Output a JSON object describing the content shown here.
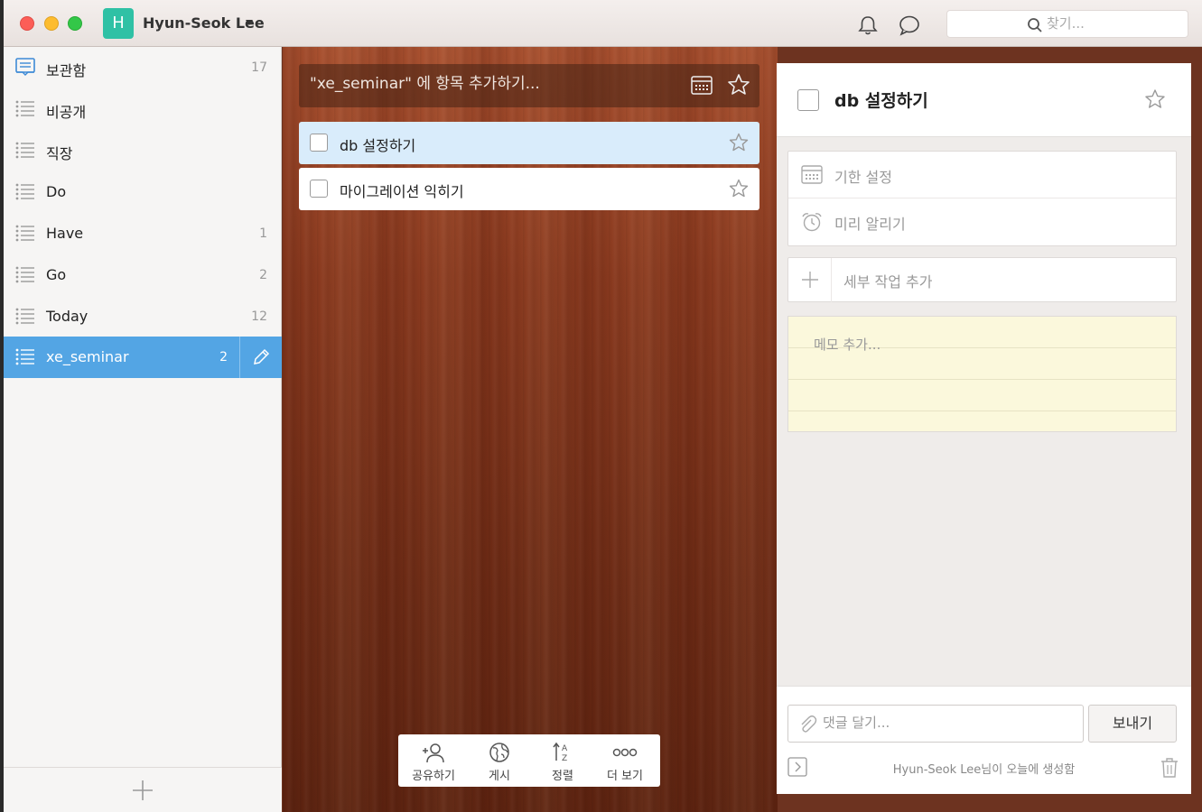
{
  "user": {
    "initial": "H",
    "name": "Hyun-Seok Lee"
  },
  "search": {
    "placeholder": "찾기..."
  },
  "sidebar": {
    "items": [
      {
        "label": "보관함",
        "count": "17"
      },
      {
        "label": "비공개",
        "count": ""
      },
      {
        "label": "직장",
        "count": ""
      },
      {
        "label": "Do",
        "count": ""
      },
      {
        "label": "Have",
        "count": "1"
      },
      {
        "label": "Go",
        "count": "2"
      },
      {
        "label": "Today",
        "count": "12"
      },
      {
        "label": "xe_seminar",
        "count": "2",
        "active": true
      }
    ]
  },
  "list": {
    "add_placeholder": "\"xe_seminar\" 에 항목 추가하기...",
    "tasks": [
      {
        "title": "db 설정하기",
        "selected": true
      },
      {
        "title": "마이그레이션 익히기",
        "selected": false
      }
    ]
  },
  "toolbar": {
    "share": "공유하기",
    "publish": "게시",
    "sort": "정렬",
    "more": "더 보기"
  },
  "detail": {
    "title": "db 설정하기",
    "due_date": "기한 설정",
    "reminder": "미리 알리기",
    "subtask": "세부 작업 추가",
    "note": "메모 추가...",
    "comment_placeholder": "댓글 달기...",
    "send": "보내기",
    "created_by": "Hyun-Seok Lee님이 오늘에 생성함"
  },
  "colors": {
    "accent": "#53a5e4",
    "avatar": "#2fc1a5",
    "wood": "#8a3a1f",
    "note": "#fbf8dc"
  }
}
